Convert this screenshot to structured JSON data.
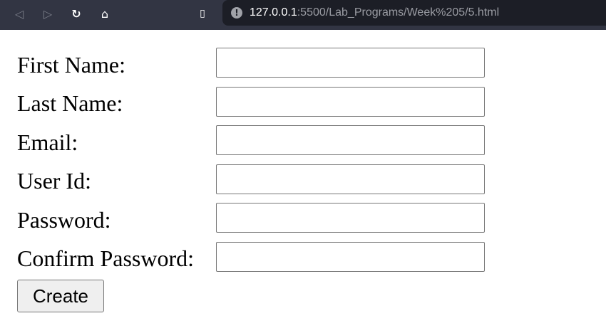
{
  "browser": {
    "url_host": "127.0.0.1",
    "url_rest": ":5500/Lab_Programs/Week%205/5.html"
  },
  "form": {
    "fields": [
      {
        "label": "First Name:",
        "value": ""
      },
      {
        "label": "Last Name:",
        "value": ""
      },
      {
        "label": "Email:",
        "value": ""
      },
      {
        "label": "User Id:",
        "value": ""
      },
      {
        "label": "Password:",
        "value": ""
      },
      {
        "label": "Confirm Password:",
        "value": ""
      }
    ],
    "submit_label": "Create"
  }
}
